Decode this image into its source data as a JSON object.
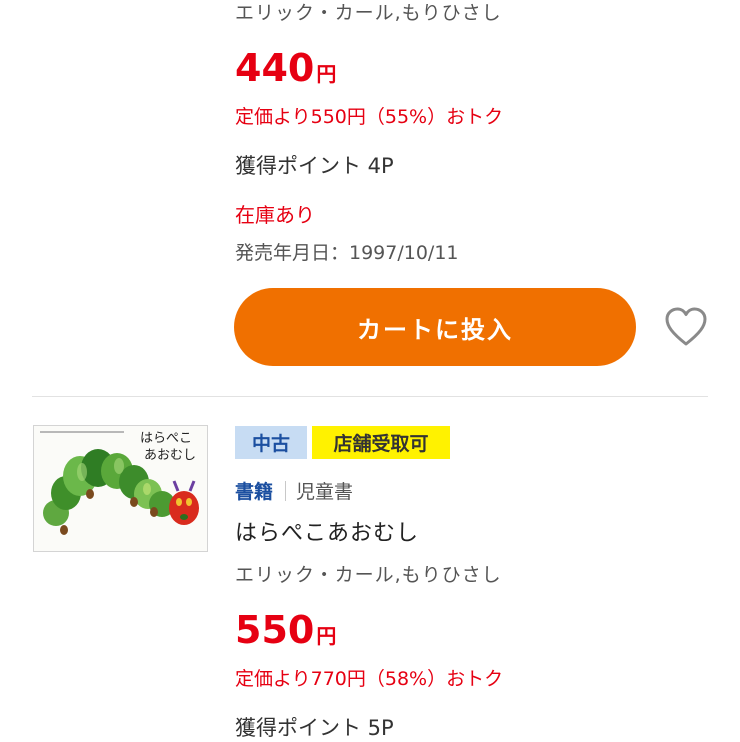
{
  "items": [
    {
      "author": "エリック・カール,もりひさし",
      "price": "440",
      "currency": "円",
      "discount": "定価より550円（55%）おトク",
      "points": "獲得ポイント 4P",
      "stock": "在庫あり",
      "release": "発売年月日：1997/10/11",
      "cart_label": "カートに投入"
    },
    {
      "badges": [
        "中古",
        "店舗受取可"
      ],
      "category": "書籍",
      "subcategory": "児童書",
      "title": "はらぺこあおむし",
      "author": "エリック・カール,もりひさし",
      "price": "550",
      "currency": "円",
      "discount": "定価より770円（58%）おトク",
      "points": "獲得ポイント 5P",
      "cover": {
        "title_line1": "はらぺこ",
        "title_line2": "あおむし"
      }
    }
  ],
  "icons": [
    "heart-icon"
  ],
  "colors": {
    "price_red": "#e60012",
    "cart_orange": "#f07000",
    "category_blue": "#1b4fa0",
    "badge_used_bg": "#c7dcf3",
    "badge_store_bg": "#fff200"
  }
}
